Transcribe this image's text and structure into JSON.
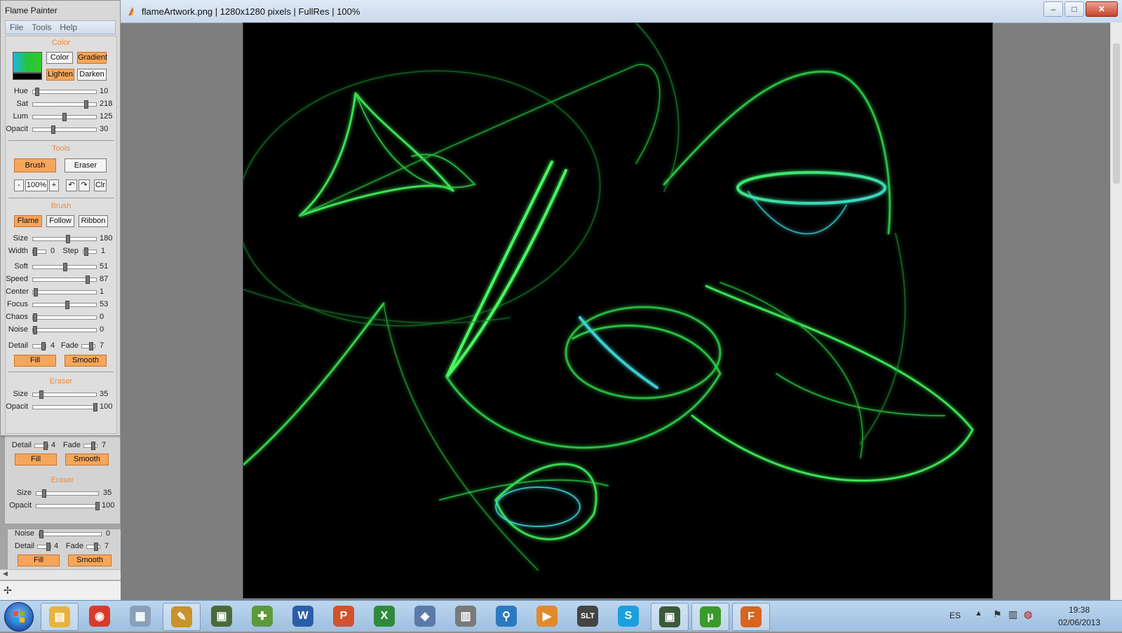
{
  "panel": {
    "title": "Flame Painter",
    "menu": [
      "File",
      "Tools",
      "Help"
    ],
    "color_section": {
      "title": "Color",
      "mode_buttons": [
        "Color",
        "Gradient"
      ],
      "blend_buttons": [
        "Lighten",
        "Darken"
      ],
      "sliders": [
        {
          "label": "Hue",
          "value": "10",
          "level": 0.04
        },
        {
          "label": "Sat",
          "value": "218",
          "level": 0.85
        },
        {
          "label": "Lum",
          "value": "125",
          "level": 0.49
        },
        {
          "label": "Opacit",
          "value": "30",
          "level": 0.3
        }
      ]
    },
    "tools_section": {
      "title": "Tools",
      "brush_button": "Brush",
      "eraser_button": "Eraser",
      "zoom_minus": "-",
      "zoom_value": "100%",
      "zoom_plus": "+",
      "undo_icon": "↶",
      "redo_icon": "↷",
      "clear_button": "Clr"
    },
    "brush_section": {
      "title": "Brush",
      "mode_buttons": [
        "Flame",
        "Follow",
        "Ribbon"
      ],
      "size": {
        "label": "Size",
        "value": "180",
        "level": 0.55
      },
      "width": {
        "label": "Width",
        "value": "0",
        "level": 0.0
      },
      "step": {
        "label": "Step",
        "value": "1",
        "level": 0.1
      },
      "sliders": [
        {
          "label": "Soft",
          "value": "51",
          "level": 0.5
        },
        {
          "label": "Speed",
          "value": "87",
          "level": 0.87
        },
        {
          "label": "Center",
          "value": "1",
          "level": 0.01
        },
        {
          "label": "Focus",
          "value": "53",
          "level": 0.53
        },
        {
          "label": "Chaos",
          "value": "0",
          "level": 0.0
        },
        {
          "label": "Noise",
          "value": "0",
          "level": 0.0
        }
      ],
      "detail": {
        "label": "Detail",
        "value": "4"
      },
      "fade": {
        "label": "Fade",
        "value": "7"
      },
      "fill_button": "Fill",
      "smooth_button": "Smooth"
    },
    "eraser_section": {
      "title": "Eraser",
      "size": {
        "label": "Size",
        "value": "35",
        "level": 0.1
      },
      "opacity": {
        "label": "Opacit",
        "value": "100",
        "level": 1.0
      }
    }
  },
  "ghost": {
    "noise": {
      "label": "Noise",
      "value": "0"
    },
    "detail": {
      "label": "Detail",
      "value": "4"
    },
    "fade": {
      "label": "Fade",
      "value": "7"
    },
    "fill_button": "Fill",
    "smooth_button": "Smooth",
    "eraser_title": "Eraser",
    "eraser_size": {
      "label": "Size",
      "value": "35"
    },
    "eraser_opacity": {
      "label": "Opacit",
      "value": "100"
    }
  },
  "main_window": {
    "title": "flameArtwork.png | 1280x1280 pixels | FullRes | 100%",
    "minimize": "–",
    "maximize": "□",
    "close": "✕"
  },
  "taskbar": {
    "apps": [
      {
        "name": "file-explorer",
        "glyph": "▤",
        "color": "#e8b33c"
      },
      {
        "name": "chrome",
        "glyph": "◉",
        "color": "#d93a2a"
      },
      {
        "name": "calculator",
        "glyph": "▦",
        "color": "#8aa0b8"
      },
      {
        "name": "paint",
        "glyph": "✎",
        "color": "#c8922c"
      },
      {
        "name": "terminal",
        "glyph": "▣",
        "color": "#4b6a3a"
      },
      {
        "name": "tool",
        "glyph": "✚",
        "color": "#5a9a3a"
      },
      {
        "name": "word",
        "glyph": "W",
        "color": "#2b5ea8"
      },
      {
        "name": "powerpoint",
        "glyph": "P",
        "color": "#d2522a"
      },
      {
        "name": "excel",
        "glyph": "X",
        "color": "#2f8a3c"
      },
      {
        "name": "virtualbox",
        "glyph": "◈",
        "color": "#5a7aa8"
      },
      {
        "name": "calendar",
        "glyph": "▥",
        "color": "#7a7a7a"
      },
      {
        "name": "search",
        "glyph": "⚲",
        "color": "#2a7ac0"
      },
      {
        "name": "presentation",
        "glyph": "▶",
        "color": "#e08a2a"
      },
      {
        "name": "slt",
        "glyph": "SLT",
        "color": "#444444"
      },
      {
        "name": "skype",
        "glyph": "S",
        "color": "#1aa0e0"
      },
      {
        "name": "monitor",
        "glyph": "▣",
        "color": "#3a5a3a"
      },
      {
        "name": "utorrent",
        "glyph": "µ",
        "color": "#3a9a2a"
      },
      {
        "name": "flame-painter",
        "glyph": "F",
        "color": "#d8641e"
      }
    ],
    "language": "ES",
    "time": "19:38",
    "date": "02/06/2013"
  },
  "colors": {
    "accent_orange": "#f6a65a",
    "section_title": "#f08a3a",
    "flame_green": "#33e04a",
    "flame_cyan": "#3fd8d8"
  }
}
